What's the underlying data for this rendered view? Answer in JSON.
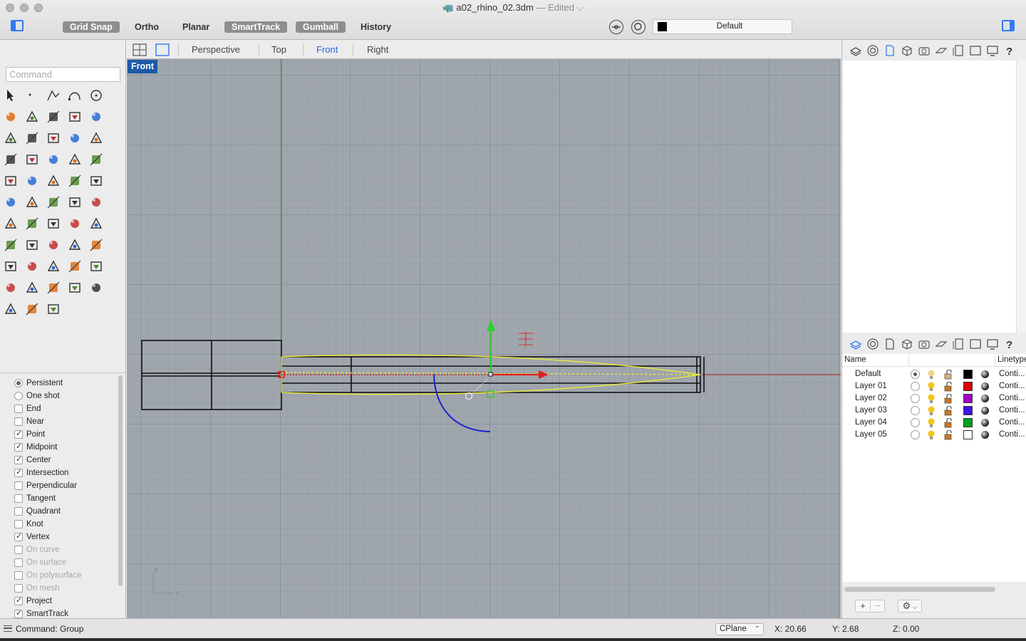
{
  "window": {
    "title": "a02_rhino_02.3dm",
    "edited_suffix": "— Edited ⌵"
  },
  "toolbar": {
    "toggles": [
      {
        "label": "Grid Snap",
        "on": true
      },
      {
        "label": "Ortho",
        "on": false
      },
      {
        "label": "Planar",
        "on": false
      },
      {
        "label": "SmartTrack",
        "on": true
      },
      {
        "label": "Gumball",
        "on": true
      },
      {
        "label": "History",
        "on": false
      }
    ],
    "current_layer": "Default",
    "current_layer_color": "#000000"
  },
  "command": {
    "placeholder": "Command"
  },
  "tool_icons": [
    "select-arrow-icon",
    "point-icon",
    "polyline-icon",
    "curve-icon",
    "circle-icon",
    "ellipse-icon",
    "arc-icon",
    "rectangle-icon",
    "polygon-icon",
    "fillet-icon",
    "surface-points-icon",
    "loft-icon",
    "box-icon",
    "boolean-icon",
    "cylinder-icon",
    "extrude-surface-icon",
    "explode-icon",
    "split-icon",
    "trim-icon",
    "extend-icon",
    "group-icon",
    "network-icon",
    "curve-from-object-icon",
    "rebuild-icon",
    "text-icon",
    "move-icon",
    "array-icon",
    "edit-points-icon",
    "solid-edit-icon",
    "dimension-icon",
    "array-grid-icon",
    "align-icon",
    "analyze-icon",
    "check-icon",
    "section-icon",
    "zoom-extents-icon",
    "zoom-icon",
    "zoom-window-icon",
    "zoom-selected-icon",
    "search-icon",
    "rotate-view-icon",
    "car-icon",
    "plane-icon",
    "snapshot-icon",
    "light-icon",
    "lock-icon",
    "layer-icon",
    "color-wheel-icon",
    "sphere-material-icon",
    "render-icon",
    "render-sphere-icon",
    "named-position-icon",
    "transform-icon"
  ],
  "osnap": {
    "modes": [
      {
        "label": "Persistent",
        "type": "radio",
        "checked": true,
        "enabled": true
      },
      {
        "label": "One shot",
        "type": "radio",
        "checked": false,
        "enabled": true
      },
      {
        "label": "End",
        "type": "check",
        "checked": false,
        "enabled": true
      },
      {
        "label": "Near",
        "type": "check",
        "checked": false,
        "enabled": true
      },
      {
        "label": "Point",
        "type": "check",
        "checked": true,
        "enabled": true
      },
      {
        "label": "Midpoint",
        "type": "check",
        "checked": true,
        "enabled": true
      },
      {
        "label": "Center",
        "type": "check",
        "checked": true,
        "enabled": true
      },
      {
        "label": "Intersection",
        "type": "check",
        "checked": true,
        "enabled": true
      },
      {
        "label": "Perpendicular",
        "type": "check",
        "checked": false,
        "enabled": true
      },
      {
        "label": "Tangent",
        "type": "check",
        "checked": false,
        "enabled": true
      },
      {
        "label": "Quadrant",
        "type": "check",
        "checked": false,
        "enabled": true
      },
      {
        "label": "Knot",
        "type": "check",
        "checked": false,
        "enabled": true
      },
      {
        "label": "Vertex",
        "type": "check",
        "checked": true,
        "enabled": true
      },
      {
        "label": "On curve",
        "type": "check",
        "checked": false,
        "enabled": false
      },
      {
        "label": "On surface",
        "type": "check",
        "checked": false,
        "enabled": false
      },
      {
        "label": "On polysurface",
        "type": "check",
        "checked": false,
        "enabled": false
      },
      {
        "label": "On mesh",
        "type": "check",
        "checked": false,
        "enabled": false
      },
      {
        "label": "Project",
        "type": "check",
        "checked": true,
        "enabled": true
      },
      {
        "label": "SmartTrack",
        "type": "check",
        "checked": true,
        "enabled": true
      }
    ]
  },
  "viewports": {
    "tabs": [
      "Perspective",
      "Top",
      "Front",
      "Right"
    ],
    "active_tab": "Front",
    "active_label": "Front",
    "axis_labels": {
      "vertical": "z",
      "horizontal": "x"
    }
  },
  "layers": {
    "columns": {
      "name": "Name",
      "linetype": "Linetype"
    },
    "rows": [
      {
        "name": "Default",
        "current": true,
        "color": "#000000",
        "linetype": "Conti..."
      },
      {
        "name": "Layer 01",
        "current": false,
        "color": "#e00000",
        "linetype": "Conti..."
      },
      {
        "name": "Layer 02",
        "current": false,
        "color": "#a000c8",
        "linetype": "Conti..."
      },
      {
        "name": "Layer 03",
        "current": false,
        "color": "#3c14e6",
        "linetype": "Conti..."
      },
      {
        "name": "Layer 04",
        "current": false,
        "color": "#00a01e",
        "linetype": "Conti..."
      },
      {
        "name": "Layer 05",
        "current": false,
        "color": "#ffffff",
        "linetype": "Conti..."
      }
    ],
    "add_label": "+",
    "remove_label": "−"
  },
  "status": {
    "command_text": "Command: Group",
    "cplane": "CPlane",
    "x": "X: 20.66",
    "y": "Y: 2.68",
    "z": "Z: 0.00"
  }
}
